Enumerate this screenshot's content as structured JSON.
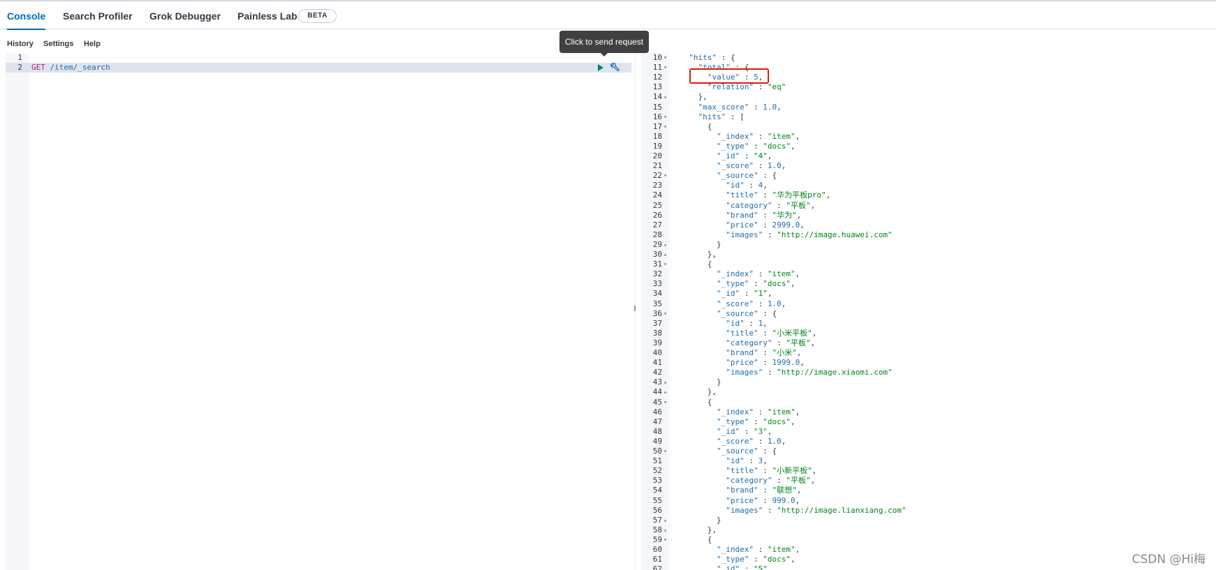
{
  "tabs": [
    {
      "label": "Console"
    },
    {
      "label": "Search Profiler"
    },
    {
      "label": "Grok Debugger"
    },
    {
      "label": "Painless Lab"
    }
  ],
  "beta_badge": "BETA",
  "subnav": {
    "history": "History",
    "settings": "Settings",
    "help": "Help"
  },
  "tooltip": "Click to send request",
  "request": {
    "line1": "1",
    "line2": "2",
    "method": "GET",
    "path": "/item/_search"
  },
  "response_lines": [
    {
      "n": "10",
      "fold": "▾",
      "code": "  \"hits\" : {"
    },
    {
      "n": "11",
      "fold": "▾",
      "code": "    \"total\" : {"
    },
    {
      "n": "12",
      "fold": "",
      "code": "      \"value\" : 5,"
    },
    {
      "n": "13",
      "fold": "",
      "code": "      \"relation\" : \"eq\""
    },
    {
      "n": "14",
      "fold": "▴",
      "code": "    },"
    },
    {
      "n": "15",
      "fold": "",
      "code": "    \"max_score\" : 1.0,"
    },
    {
      "n": "16",
      "fold": "▾",
      "code": "    \"hits\" : ["
    },
    {
      "n": "17",
      "fold": "▾",
      "code": "      {"
    },
    {
      "n": "18",
      "fold": "",
      "code": "        \"_index\" : \"item\","
    },
    {
      "n": "19",
      "fold": "",
      "code": "        \"_type\" : \"docs\","
    },
    {
      "n": "20",
      "fold": "",
      "code": "        \"_id\" : \"4\","
    },
    {
      "n": "21",
      "fold": "",
      "code": "        \"_score\" : 1.0,"
    },
    {
      "n": "22",
      "fold": "▾",
      "code": "        \"_source\" : {"
    },
    {
      "n": "23",
      "fold": "",
      "code": "          \"id\" : 4,"
    },
    {
      "n": "24",
      "fold": "",
      "code": "          \"title\" : \"华为平板pro\","
    },
    {
      "n": "25",
      "fold": "",
      "code": "          \"category\" : \"平板\","
    },
    {
      "n": "26",
      "fold": "",
      "code": "          \"brand\" : \"华为\","
    },
    {
      "n": "27",
      "fold": "",
      "code": "          \"price\" : 2999.0,"
    },
    {
      "n": "28",
      "fold": "",
      "code": "          \"images\" : \"http://image.huawei.com\""
    },
    {
      "n": "29",
      "fold": "▴",
      "code": "        }"
    },
    {
      "n": "30",
      "fold": "▴",
      "code": "      },"
    },
    {
      "n": "31",
      "fold": "▾",
      "code": "      {"
    },
    {
      "n": "32",
      "fold": "",
      "code": "        \"_index\" : \"item\","
    },
    {
      "n": "33",
      "fold": "",
      "code": "        \"_type\" : \"docs\","
    },
    {
      "n": "34",
      "fold": "",
      "code": "        \"_id\" : \"1\","
    },
    {
      "n": "35",
      "fold": "",
      "code": "        \"_score\" : 1.0,"
    },
    {
      "n": "36",
      "fold": "▾",
      "code": "        \"_source\" : {"
    },
    {
      "n": "37",
      "fold": "",
      "code": "          \"id\" : 1,"
    },
    {
      "n": "38",
      "fold": "",
      "code": "          \"title\" : \"小米平板\","
    },
    {
      "n": "39",
      "fold": "",
      "code": "          \"category\" : \"平板\","
    },
    {
      "n": "40",
      "fold": "",
      "code": "          \"brand\" : \"小米\","
    },
    {
      "n": "41",
      "fold": "",
      "code": "          \"price\" : 1999.0,"
    },
    {
      "n": "42",
      "fold": "",
      "code": "          \"images\" : \"http://image.xiaomi.com\""
    },
    {
      "n": "43",
      "fold": "▴",
      "code": "        }"
    },
    {
      "n": "44",
      "fold": "▴",
      "code": "      },"
    },
    {
      "n": "45",
      "fold": "▾",
      "code": "      {"
    },
    {
      "n": "46",
      "fold": "",
      "code": "        \"_index\" : \"item\","
    },
    {
      "n": "47",
      "fold": "",
      "code": "        \"_type\" : \"docs\","
    },
    {
      "n": "48",
      "fold": "",
      "code": "        \"_id\" : \"3\","
    },
    {
      "n": "49",
      "fold": "",
      "code": "        \"_score\" : 1.0,"
    },
    {
      "n": "50",
      "fold": "▾",
      "code": "        \"_source\" : {"
    },
    {
      "n": "51",
      "fold": "",
      "code": "          \"id\" : 3,"
    },
    {
      "n": "52",
      "fold": "",
      "code": "          \"title\" : \"小新平板\","
    },
    {
      "n": "53",
      "fold": "",
      "code": "          \"category\" : \"平板\","
    },
    {
      "n": "54",
      "fold": "",
      "code": "          \"brand\" : \"联想\","
    },
    {
      "n": "55",
      "fold": "",
      "code": "          \"price\" : 999.0,"
    },
    {
      "n": "56",
      "fold": "",
      "code": "          \"images\" : \"http://image.lianxiang.com\""
    },
    {
      "n": "57",
      "fold": "▴",
      "code": "        }"
    },
    {
      "n": "58",
      "fold": "▴",
      "code": "      },"
    },
    {
      "n": "59",
      "fold": "▾",
      "code": "      {"
    },
    {
      "n": "60",
      "fold": "",
      "code": "        \"_index\" : \"item\","
    },
    {
      "n": "61",
      "fold": "",
      "code": "        \"_type\" : \"docs\","
    },
    {
      "n": "62",
      "fold": "",
      "code": "        \"_id\" : \"5\","
    }
  ],
  "watermark": "CSDN @Hi梅",
  "colors": {
    "accent": "#006bb8",
    "highlight_box": "#e3170a",
    "string": "#00851a",
    "key": "#1f6ca8",
    "method": "#b0246e"
  }
}
